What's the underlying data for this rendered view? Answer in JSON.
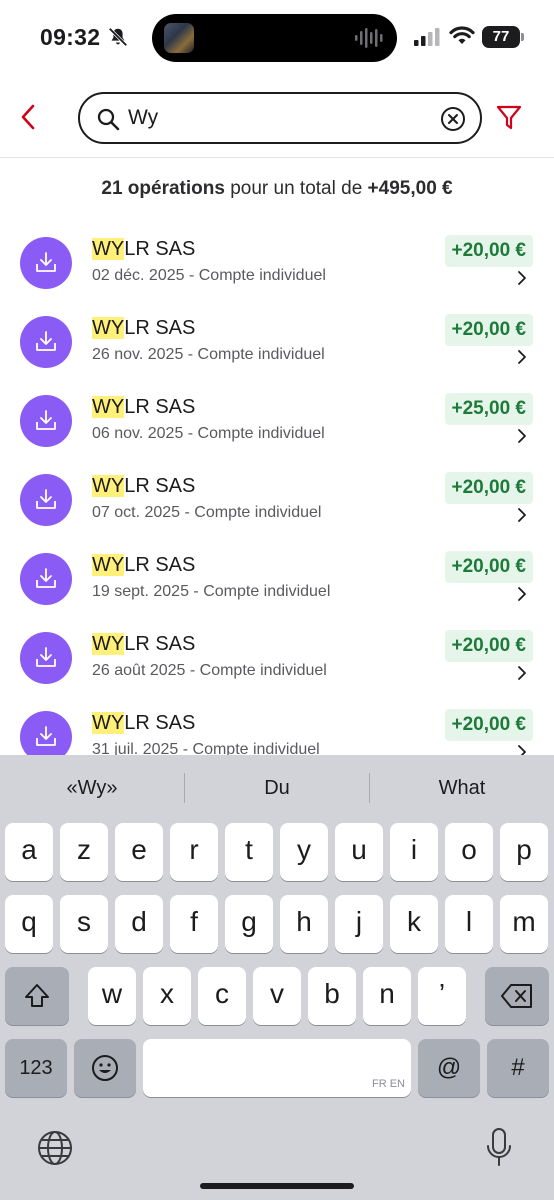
{
  "status_bar": {
    "time": "09:32",
    "battery": "77"
  },
  "search": {
    "query": "Wy"
  },
  "summary": {
    "count": "21 opérations",
    "middle": " pour un total de ",
    "total": "+495,00 €"
  },
  "operations": [
    {
      "highlight": "WY",
      "rest": "LR SAS",
      "sub": "02 déc. 2025 - Compte individuel",
      "amount": "+20,00 €"
    },
    {
      "highlight": "WY",
      "rest": "LR SAS",
      "sub": "26 nov. 2025 - Compte individuel",
      "amount": "+20,00 €"
    },
    {
      "highlight": "WY",
      "rest": "LR SAS",
      "sub": "06 nov. 2025 - Compte individuel",
      "amount": "+25,00 €"
    },
    {
      "highlight": "WY",
      "rest": "LR SAS",
      "sub": "07 oct. 2025 - Compte individuel",
      "amount": "+20,00 €"
    },
    {
      "highlight": "WY",
      "rest": "LR SAS",
      "sub": "19 sept. 2025 - Compte individuel",
      "amount": "+20,00 €"
    },
    {
      "highlight": "WY",
      "rest": "LR SAS",
      "sub": "26 août 2025 - Compte individuel",
      "amount": "+20,00 €"
    },
    {
      "highlight": "WY",
      "rest": "LR SAS",
      "sub": "31 juil. 2025 - Compte individuel",
      "amount": "+20,00 €"
    }
  ],
  "keyboard": {
    "suggestions": [
      "«Wy»",
      "Du",
      "What"
    ],
    "row1": [
      "a",
      "z",
      "e",
      "r",
      "t",
      "y",
      "u",
      "i",
      "o",
      "p"
    ],
    "row2": [
      "q",
      "s",
      "d",
      "f",
      "g",
      "h",
      "j",
      "k",
      "l",
      "m"
    ],
    "row3": [
      "w",
      "x",
      "c",
      "v",
      "b",
      "n",
      "’"
    ],
    "numbers_key": "123",
    "at_key": "@",
    "hash_key": "#",
    "space_hint": "FR EN"
  },
  "colors": {
    "accent_red": "#d0021b",
    "op_icon": "#8a5cf5",
    "amount_green": "#1e7a3b",
    "amount_bg": "#e6f5ea",
    "highlight": "#fff07a"
  }
}
